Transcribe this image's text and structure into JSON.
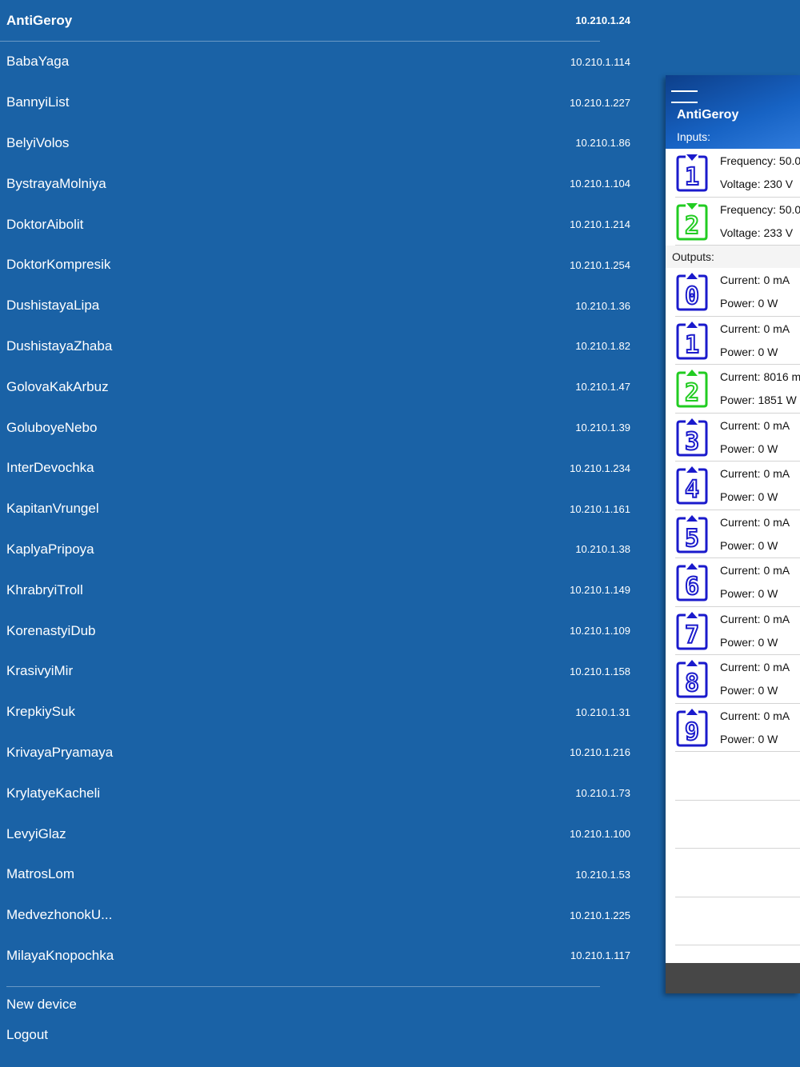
{
  "devices": [
    {
      "name": "AntiGeroy",
      "ip": "10.210.1.24"
    },
    {
      "name": "BabaYaga",
      "ip": "10.210.1.114"
    },
    {
      "name": "BannyiList",
      "ip": "10.210.1.227"
    },
    {
      "name": "BelyiVolos",
      "ip": "10.210.1.86"
    },
    {
      "name": "BystrayaMolniya",
      "ip": "10.210.1.104"
    },
    {
      "name": "DoktorAibolit",
      "ip": "10.210.1.214"
    },
    {
      "name": "DoktorKompresik",
      "ip": "10.210.1.254"
    },
    {
      "name": "DushistayaLipa",
      "ip": "10.210.1.36"
    },
    {
      "name": "DushistayaZhaba",
      "ip": "10.210.1.82"
    },
    {
      "name": "GolovaKakArbuz",
      "ip": "10.210.1.47"
    },
    {
      "name": "GoluboyeNebo",
      "ip": "10.210.1.39"
    },
    {
      "name": "InterDevochka",
      "ip": "10.210.1.234"
    },
    {
      "name": "KapitanVrungel",
      "ip": "10.210.1.161"
    },
    {
      "name": "KaplyaPripoya",
      "ip": "10.210.1.38"
    },
    {
      "name": "KhrabryiTroll",
      "ip": "10.210.1.149"
    },
    {
      "name": "KorenastyiDub",
      "ip": "10.210.1.109"
    },
    {
      "name": "KrasivyiMir",
      "ip": "10.210.1.158"
    },
    {
      "name": "KrepkiySuk",
      "ip": "10.210.1.31"
    },
    {
      "name": "KrivayaPryamaya",
      "ip": "10.210.1.216"
    },
    {
      "name": "KrylatyeKacheli",
      "ip": "10.210.1.73"
    },
    {
      "name": "LevyiGlaz",
      "ip": "10.210.1.100"
    },
    {
      "name": "MatrosLom",
      "ip": "10.210.1.53"
    },
    {
      "name": "MedvezhonokU...",
      "ip": "10.210.1.225"
    },
    {
      "name": "MilayaKnopochka",
      "ip": "10.210.1.117"
    }
  ],
  "actions": {
    "new_device": "New device",
    "logout": "Logout"
  },
  "panel": {
    "title": "AntiGeroy",
    "inputs_label": "Inputs:",
    "outputs_label": "Outputs:",
    "inputs": [
      {
        "digit": "1",
        "color": "#1a1acc",
        "line1": "Frequency: 50.0",
        "line2": "Voltage: 230 V"
      },
      {
        "digit": "2",
        "color": "#22cc22",
        "line1": "Frequency: 50.0",
        "line2": "Voltage: 233 V"
      }
    ],
    "outputs": [
      {
        "digit": "0",
        "color": "#1a1acc",
        "line1": "Current: 0 mA",
        "line2": "Power: 0 W"
      },
      {
        "digit": "1",
        "color": "#1a1acc",
        "line1": "Current: 0 mA",
        "line2": "Power: 0 W"
      },
      {
        "digit": "2",
        "color": "#22cc22",
        "line1": "Current: 8016 m",
        "line2": "Power: 1851 W"
      },
      {
        "digit": "3",
        "color": "#1a1acc",
        "line1": "Current: 0 mA",
        "line2": "Power: 0 W"
      },
      {
        "digit": "4",
        "color": "#1a1acc",
        "line1": "Current: 0 mA",
        "line2": "Power: 0 W"
      },
      {
        "digit": "5",
        "color": "#1a1acc",
        "line1": "Current: 0 mA",
        "line2": "Power: 0 W"
      },
      {
        "digit": "6",
        "color": "#1a1acc",
        "line1": "Current: 0 mA",
        "line2": "Power: 0 W"
      },
      {
        "digit": "7",
        "color": "#1a1acc",
        "line1": "Current: 0 mA",
        "line2": "Power: 0 W"
      },
      {
        "digit": "8",
        "color": "#1a1acc",
        "line1": "Current: 0 mA",
        "line2": "Power: 0 W"
      },
      {
        "digit": "9",
        "color": "#1a1acc",
        "line1": "Current: 0 mA",
        "line2": "Power: 0 W"
      }
    ]
  },
  "colors": {
    "background": "#1a62a6",
    "off_icon": "#1a1acc",
    "on_icon": "#22cc22",
    "footer": "#474747"
  }
}
